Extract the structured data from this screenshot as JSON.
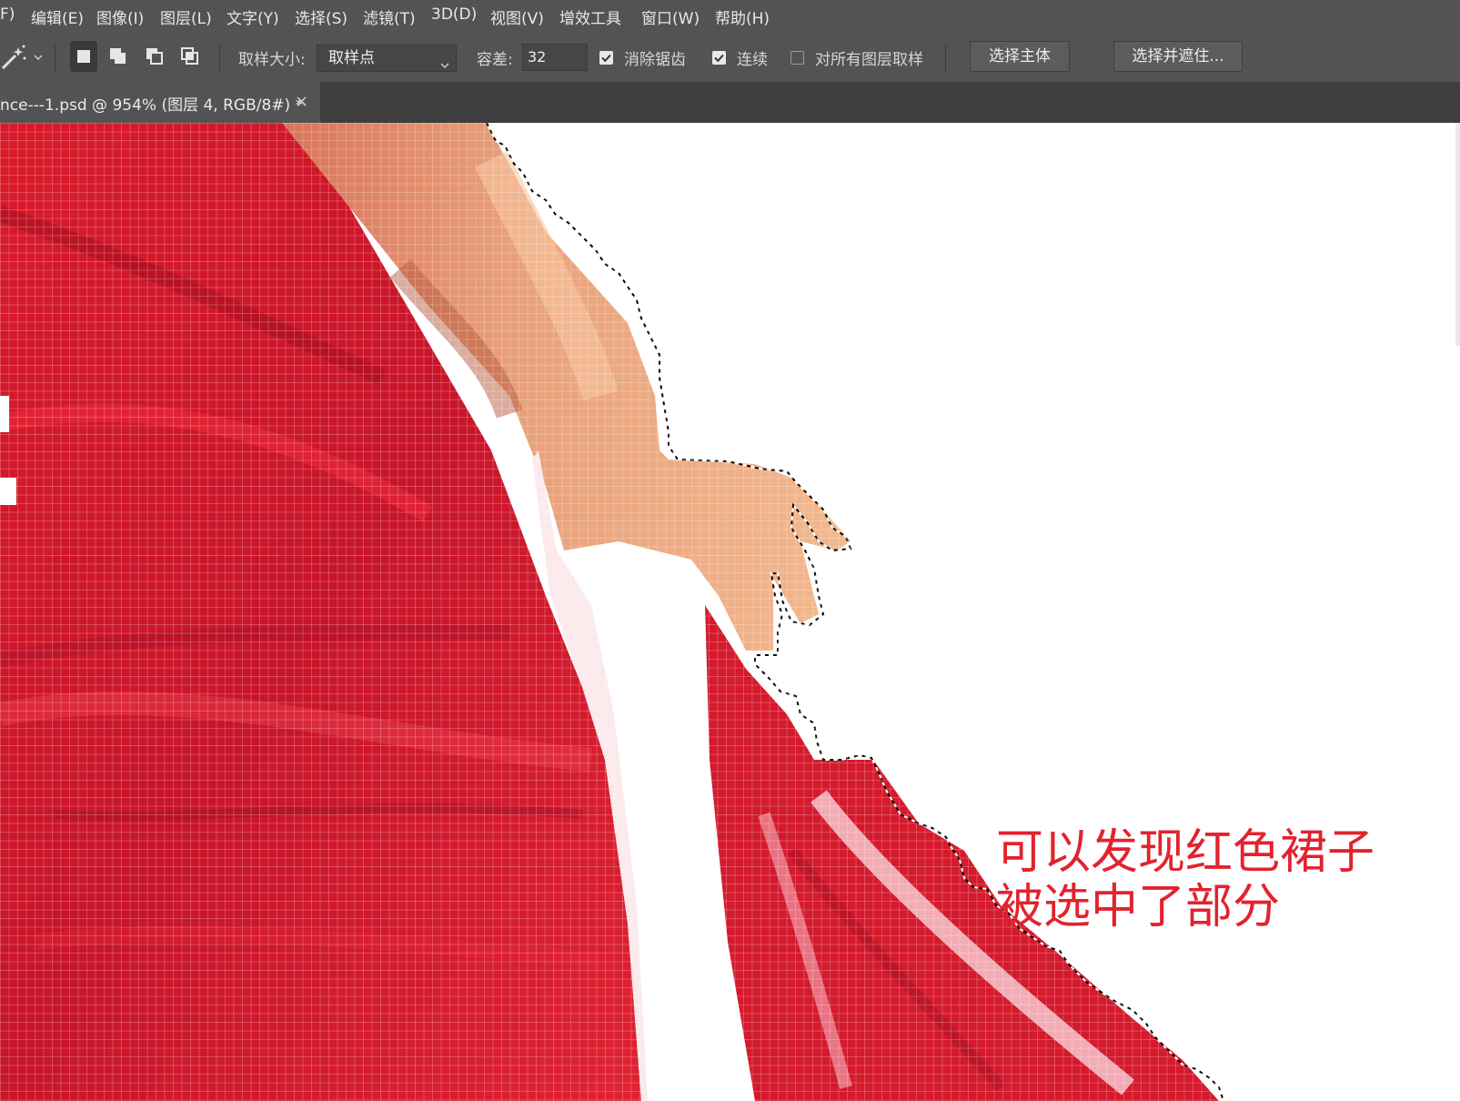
{
  "menu": {
    "items": [
      "F)",
      "编辑(E)",
      "图像(I)",
      "图层(L)",
      "文字(Y)",
      "选择(S)",
      "滤镜(T)",
      "3D(D)",
      "视图(V)",
      "增效工具",
      "窗口(W)",
      "帮助(H)"
    ]
  },
  "options": {
    "tool_icon": "magic-wand-icon",
    "sample_size_label": "取样大小:",
    "sample_size_value": "取样点",
    "tolerance_label": "容差:",
    "tolerance_value": "32",
    "anti_alias_label": "消除锯齿",
    "anti_alias_checked": true,
    "contiguous_label": "连续",
    "contiguous_checked": true,
    "sample_all_layers_label": "对所有图层取样",
    "sample_all_layers_checked": false,
    "select_subject_button": "选择主体",
    "select_mask_button": "选择并遮住..."
  },
  "tab": {
    "title": "nce---1.psd @ 954% (图层 4, RGB/8#) *",
    "close": "×"
  },
  "canvas": {
    "annotation_line1": "可以发现红色裙子",
    "annotation_line2": "被选中了部分",
    "annotation_color": "#e3222e",
    "dress_color": "#d61b2c",
    "skin_color": "#e9a47c"
  }
}
